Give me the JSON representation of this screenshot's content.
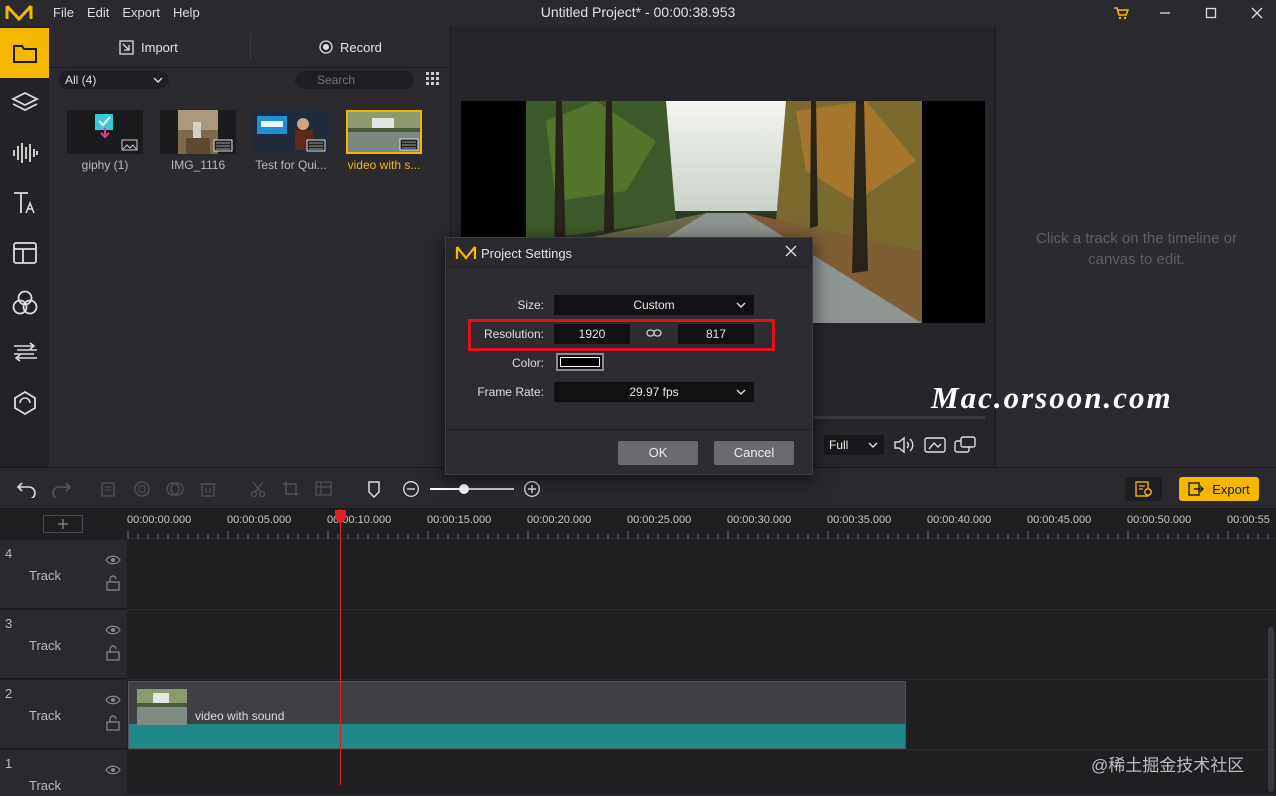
{
  "app": {
    "window_title": "Untitled Project* - 00:00:38.953",
    "brand_color": "#f5b700",
    "menu": [
      "File",
      "Edit",
      "Export",
      "Help"
    ]
  },
  "toolstrip": {
    "items": [
      "media-icon",
      "layers-icon",
      "audio-icon",
      "text-icon",
      "templates-icon",
      "filters-icon",
      "transitions-icon",
      "effects-icon"
    ],
    "active": "media-icon"
  },
  "media": {
    "import_label": "Import",
    "record_label": "Record",
    "filter_value": "All (4)",
    "search_placeholder": "Search",
    "items": [
      {
        "label": "giphy (1)",
        "selected": false
      },
      {
        "label": "IMG_1116",
        "selected": false
      },
      {
        "label": "Test for Qui...",
        "selected": false
      },
      {
        "label": "video with s...",
        "selected": true
      }
    ]
  },
  "preview": {
    "zoom_value": "Full"
  },
  "properties": {
    "message": "Click a track on the timeline or canvas to edit."
  },
  "watermark": "Mac.orsoon.com",
  "timeline": {
    "export_label": "Export",
    "ruler_ticks": [
      "00:00:00.000",
      "00:00:05.000",
      "00:00:10.000",
      "00:00:15.000",
      "00:00:20.000",
      "00:00:25.000",
      "00:00:30.000",
      "00:00:35.000",
      "00:00:40.000",
      "00:00:45.000",
      "00:00:50.000",
      "00:00:55"
    ],
    "tracks": [
      {
        "number": "4",
        "name": "Track"
      },
      {
        "number": "3",
        "name": "Track"
      },
      {
        "number": "2",
        "name": "Track"
      },
      {
        "number": "1",
        "name": "Track"
      }
    ],
    "clip_label": "video with sound",
    "zoom_level": 0.4
  },
  "dialog": {
    "title": "Project Settings",
    "size_label": "Size:",
    "size_value": "Custom",
    "resolution_label": "Resolution:",
    "width_value": "1920",
    "height_value": "817",
    "color_label": "Color:",
    "color_value": "#000000",
    "framerate_label": "Frame Rate:",
    "framerate_value": "29.97 fps",
    "ok_label": "OK",
    "cancel_label": "Cancel",
    "highlight_color": "#e4101a"
  },
  "attribution": "@稀土掘金技术社区"
}
